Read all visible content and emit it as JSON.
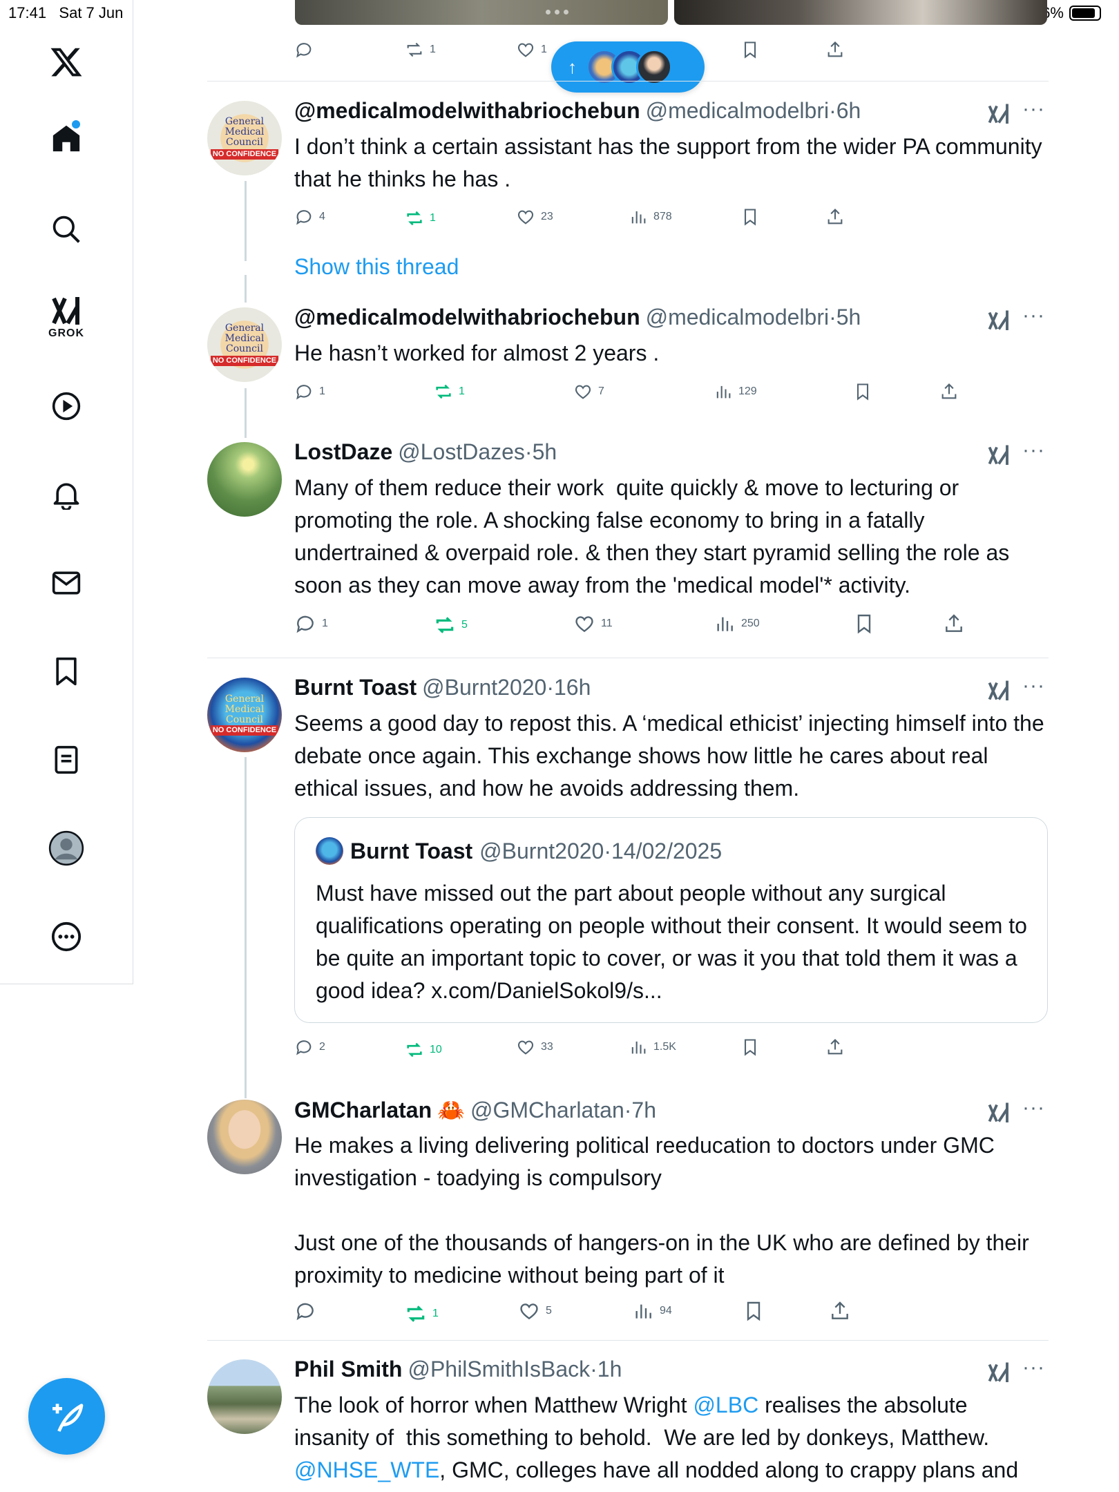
{
  "status": {
    "time": "17:41",
    "date": "Sat 7 Jun",
    "battery": "86%",
    "battery_level": 0.86
  },
  "sidebar": {
    "grok_label": "GROK"
  },
  "top_tweet_actions": {
    "replies": "",
    "reposts": "1",
    "likes": "1"
  },
  "new_posts_pill": {
    "arrow": "↑"
  },
  "tweets": [
    {
      "name": "@medicalmodelwithabriochebun",
      "handle": "@medicalmodelbri",
      "time": "6h",
      "text": "I don’t think a certain assistant has the support from the wider PA community that he thinks he has .",
      "replies": "4",
      "reposts": "1",
      "likes": "23",
      "views": "878",
      "avatar_text": [
        "General",
        "Medical",
        "Council"
      ],
      "avatar_badge": "NO CONFIDENCE"
    },
    {
      "name": "@medicalmodelwithabriochebun",
      "handle": "@medicalmodelbri",
      "time": "5h",
      "text": "He hasn’t worked for almost 2 years .",
      "replies": "1",
      "reposts": "1",
      "likes": "7",
      "views": "129",
      "avatar_text": [
        "General",
        "Medical",
        "Council"
      ],
      "avatar_badge": "NO CONFIDENCE"
    },
    {
      "name": "LostDaze",
      "handle": "@LostDazes",
      "time": "5h",
      "text": "Many of them reduce their work  quite quickly & move to lecturing or promoting the role. A shocking false economy to bring in a fatally undertrained & overpaid role. & then they start pyramid selling the role as soon as they can move away from the 'medical model'* activity.",
      "replies": "1",
      "reposts": "5",
      "likes": "11",
      "views": "250"
    },
    {
      "name": "Burnt Toast",
      "handle": "@Burnt2020",
      "time": "16h",
      "text": "Seems a good day to repost this. A ‘medical ethicist’ injecting himself into the debate once again. This exchange shows how little he cares about real ethical issues, and how he avoids addressing them.",
      "replies": "2",
      "reposts": "10",
      "likes": "33",
      "views": "1.5K",
      "avatar_text": [
        "General",
        "Medical",
        "Council"
      ],
      "avatar_badge": "NO CONFIDENCE",
      "quote": {
        "name": "Burnt Toast",
        "handle": "@Burnt2020",
        "date": "14/02/2025",
        "text": "Must have missed out the part about people without any surgical qualifications operating on people without their consent. It would seem to be quite an important topic to cover, or was it you that told them it was a good idea? x.com/DanielSokol9/s..."
      }
    },
    {
      "name": "GMCharlatan",
      "emoji": "🦀",
      "handle": "@GMCharlatan",
      "time": "7h",
      "text": "He makes a living delivering political reeducation to doctors under GMC investigation - toadying is compulsory\n\nJust one of the thousands of hangers-on in the UK who are defined by their proximity to medicine without being part of it",
      "replies": "",
      "reposts": "1",
      "likes": "5",
      "views": "94"
    },
    {
      "name": "Phil Smith",
      "handle": "@PhilSmithIsBack",
      "time": "1h",
      "text_before_mention": "The look of horror when Matthew Wright ",
      "mention_1": "@LBC",
      "text_after_mention": " realises the absolute insanity of  this something to behold.  We are led by donkeys, Matthew. ",
      "mention_2": "@NHSE_WTE",
      "text_end": ", GMC, colleges have all nodded along to crappy plans and"
    }
  ],
  "sep": "·"
}
